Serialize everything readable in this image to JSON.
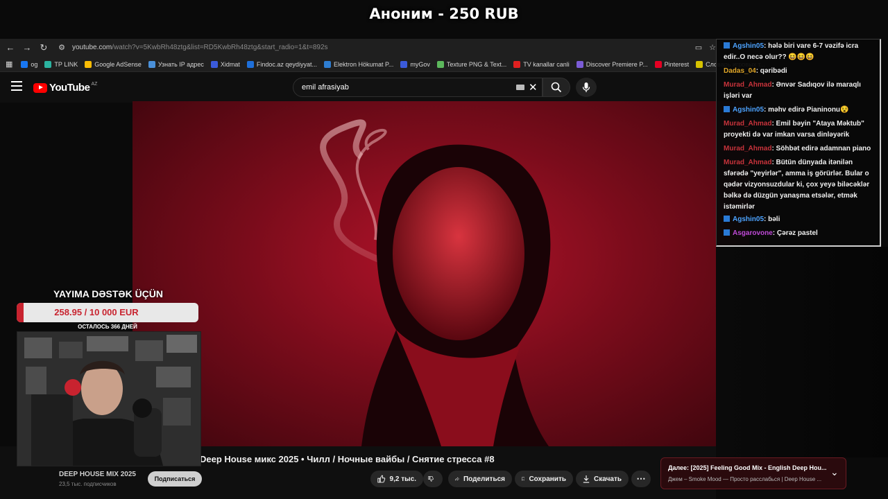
{
  "alert": {
    "title": "Аноним - 250 RUB"
  },
  "browser": {
    "url_host": "youtube.com",
    "url_path": "/watch?v=5KwbRh48ztg&list=RD5KwbRh48ztg&start_radio=1&t=892s",
    "bookmarks": [
      {
        "label": "og",
        "color": "#1877f2"
      },
      {
        "label": "TP LINK",
        "color": "#2bb3a0"
      },
      {
        "label": "Google AdSense",
        "color": "#fbbc04"
      },
      {
        "label": "Узнать IP адрес",
        "color": "#4a90d9"
      },
      {
        "label": "Xidmat",
        "color": "#3b5bdb"
      },
      {
        "label": "Findoc.az qeydiyyat...",
        "color": "#1e6fd9"
      },
      {
        "label": "Elektron Hökumat P...",
        "color": "#2e7dd1"
      },
      {
        "label": "myGov",
        "color": "#3b5bdb"
      },
      {
        "label": "Texture PNG & Text...",
        "color": "#5cb85c"
      },
      {
        "label": "TV kanallar canli",
        "color": "#e02020"
      },
      {
        "label": "Discover Premiere P...",
        "color": "#7b5cd6"
      },
      {
        "label": "Pinterest",
        "color": "#e60023"
      },
      {
        "label": "Словарь игровых т...",
        "color": "#d6c200"
      }
    ]
  },
  "youtube": {
    "logo": "YouTube",
    "region": "AZ",
    "search_value": "emil afrasiyab"
  },
  "video": {
    "title": "Deep House микс 2025 • Чилл / Ночные вайбы / Снятие стресса #8",
    "channel": "DEEP HOUSE MIX 2025",
    "subs": "23,5 тыс. подписчиков",
    "subscribe": "Подписаться",
    "likes": "9,2 тыс.",
    "share": "Поделиться",
    "save": "Сохранить",
    "download": "Скачать"
  },
  "up_next": {
    "title": "Далее: [2025] Feeling Good Mix - English Deep Hou...",
    "subtitle": "Джем – Smoke Mood — Просто расслабься | Deep House ..."
  },
  "chat": {
    "messages": [
      {
        "user": "Agshin05",
        "color": "blue",
        "badge": true,
        "text": ": hələ biri vare 6-7 vəzifə icra edir..O necə olur?? 😆😆😆"
      },
      {
        "user": "Dadas_04",
        "color": "gold",
        "badge": false,
        "text": ": qəribədi"
      },
      {
        "user": "Murad_Ahmad",
        "color": "red",
        "badge": false,
        "text": ": Ənvər Sadıqov ilə maraqlı işləri var"
      },
      {
        "user": "Agshin05",
        "color": "blue",
        "badge": true,
        "text": ": məhv edirə Pianinonu😵"
      },
      {
        "user": "Murad_Ahmad",
        "color": "red",
        "badge": false,
        "text": ": Emil bəyin \"Ataya Məktub\" proyekti də var imkan varsa dinləyərik"
      },
      {
        "user": "Murad_Ahmad",
        "color": "red",
        "badge": false,
        "text": ": Söhbət edirə adamnan piano"
      },
      {
        "user": "Murad_Ahmad",
        "color": "red",
        "badge": false,
        "text": ": Bütün dünyada itənilən sfərədə \"yeyirlər\", amma iş görürlər. Bular o qədər vizyonsuzdular ki, çox yeyə biləcəklər bəlkə də düzgün yanaşma etsələr, etmək istəmirlər"
      },
      {
        "user": "Agshin05",
        "color": "blue",
        "badge": true,
        "text": ": bəli"
      },
      {
        "user": "Asgarovone",
        "color": "purple",
        "badge": true,
        "text": ": Çərəz pastel"
      }
    ]
  },
  "donation": {
    "title": "YAYIMA DƏSTƏK ÜÇÜN",
    "progress_text": "258.95 / 10 000 EUR",
    "progress_fraction": 0.026,
    "days_left": "ОСТАЛОСЬ 366 ДНЕЙ"
  }
}
